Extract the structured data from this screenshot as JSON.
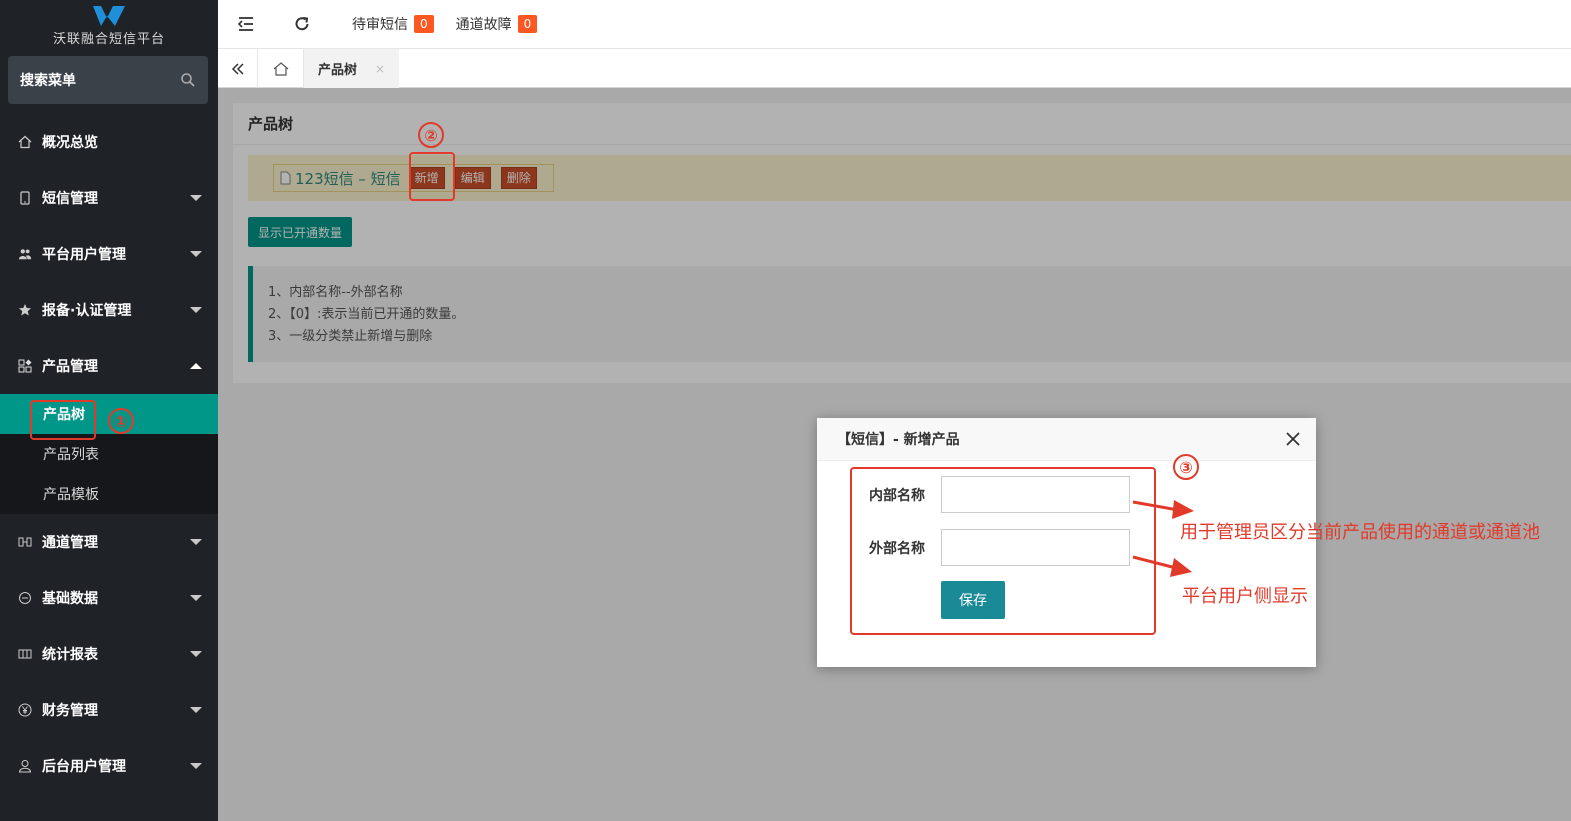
{
  "brand": {
    "title": "沃联融合短信平台"
  },
  "search": {
    "placeholder": "搜索菜单"
  },
  "sidebar": {
    "items": [
      {
        "label": "概况总览",
        "icon": "home-icon",
        "caret": "none"
      },
      {
        "label": "短信管理",
        "icon": "phone-icon",
        "caret": "down"
      },
      {
        "label": "平台用户管理",
        "icon": "users-icon",
        "caret": "down"
      },
      {
        "label": "报备·认证管理",
        "icon": "star-icon",
        "caret": "down"
      },
      {
        "label": "产品管理",
        "icon": "grid-icon",
        "caret": "up"
      }
    ],
    "sub_items": [
      {
        "label": "产品树",
        "active": true
      },
      {
        "label": "产品列表",
        "active": false
      },
      {
        "label": "产品模板",
        "active": false
      }
    ],
    "items_after": [
      {
        "label": "通道管理",
        "icon": "channel-icon",
        "caret": "down"
      },
      {
        "label": "基础数据",
        "icon": "data-icon",
        "caret": "down"
      },
      {
        "label": "统计报表",
        "icon": "report-icon",
        "caret": "down"
      },
      {
        "label": "财务管理",
        "icon": "yen-icon",
        "caret": "down"
      },
      {
        "label": "后台用户管理",
        "icon": "user-icon",
        "caret": "down"
      }
    ]
  },
  "topbar": {
    "pending_sms_label": "待审短信",
    "pending_sms_count": "0",
    "channel_fault_label": "通道故障",
    "channel_fault_count": "0"
  },
  "tabs": {
    "active_label": "产品树",
    "close": "×"
  },
  "page": {
    "title": "产品树",
    "tree_node_name": "123短信 – 短信",
    "btn_add": "新增",
    "btn_edit": "编辑",
    "btn_delete": "删除",
    "show_count_btn": "显示已开通数量",
    "notes": [
      "1、内部名称--外部名称",
      "2、【0】:表示当前已开通的数量。",
      "3、一级分类禁止新增与删除"
    ]
  },
  "dialog": {
    "title": "【短信】- 新增产品",
    "inner_name_label": "内部名称",
    "inner_name_value": "",
    "outer_name_label": "外部名称",
    "outer_name_value": "",
    "save_label": "保存"
  },
  "annotations": {
    "step1": "①",
    "step2": "②",
    "step3": "③",
    "inner_desc": "用于管理员区分当前产品使用的通道或通道池",
    "outer_desc": "平台用户侧显示",
    "color": "#e23a2a"
  }
}
